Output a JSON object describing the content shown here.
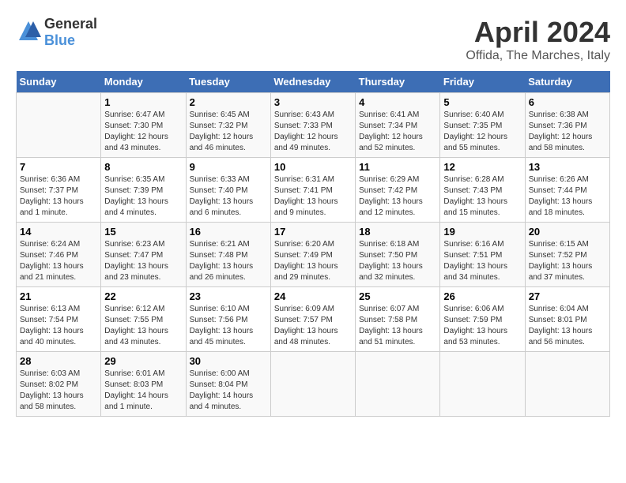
{
  "logo": {
    "general": "General",
    "blue": "Blue"
  },
  "title": "April 2024",
  "subtitle": "Offida, The Marches, Italy",
  "days_header": [
    "Sunday",
    "Monday",
    "Tuesday",
    "Wednesday",
    "Thursday",
    "Friday",
    "Saturday"
  ],
  "weeks": [
    [
      {
        "day": "",
        "info": ""
      },
      {
        "day": "1",
        "info": "Sunrise: 6:47 AM\nSunset: 7:30 PM\nDaylight: 12 hours\nand 43 minutes."
      },
      {
        "day": "2",
        "info": "Sunrise: 6:45 AM\nSunset: 7:32 PM\nDaylight: 12 hours\nand 46 minutes."
      },
      {
        "day": "3",
        "info": "Sunrise: 6:43 AM\nSunset: 7:33 PM\nDaylight: 12 hours\nand 49 minutes."
      },
      {
        "day": "4",
        "info": "Sunrise: 6:41 AM\nSunset: 7:34 PM\nDaylight: 12 hours\nand 52 minutes."
      },
      {
        "day": "5",
        "info": "Sunrise: 6:40 AM\nSunset: 7:35 PM\nDaylight: 12 hours\nand 55 minutes."
      },
      {
        "day": "6",
        "info": "Sunrise: 6:38 AM\nSunset: 7:36 PM\nDaylight: 12 hours\nand 58 minutes."
      }
    ],
    [
      {
        "day": "7",
        "info": "Sunrise: 6:36 AM\nSunset: 7:37 PM\nDaylight: 13 hours\nand 1 minute."
      },
      {
        "day": "8",
        "info": "Sunrise: 6:35 AM\nSunset: 7:39 PM\nDaylight: 13 hours\nand 4 minutes."
      },
      {
        "day": "9",
        "info": "Sunrise: 6:33 AM\nSunset: 7:40 PM\nDaylight: 13 hours\nand 6 minutes."
      },
      {
        "day": "10",
        "info": "Sunrise: 6:31 AM\nSunset: 7:41 PM\nDaylight: 13 hours\nand 9 minutes."
      },
      {
        "day": "11",
        "info": "Sunrise: 6:29 AM\nSunset: 7:42 PM\nDaylight: 13 hours\nand 12 minutes."
      },
      {
        "day": "12",
        "info": "Sunrise: 6:28 AM\nSunset: 7:43 PM\nDaylight: 13 hours\nand 15 minutes."
      },
      {
        "day": "13",
        "info": "Sunrise: 6:26 AM\nSunset: 7:44 PM\nDaylight: 13 hours\nand 18 minutes."
      }
    ],
    [
      {
        "day": "14",
        "info": "Sunrise: 6:24 AM\nSunset: 7:46 PM\nDaylight: 13 hours\nand 21 minutes."
      },
      {
        "day": "15",
        "info": "Sunrise: 6:23 AM\nSunset: 7:47 PM\nDaylight: 13 hours\nand 23 minutes."
      },
      {
        "day": "16",
        "info": "Sunrise: 6:21 AM\nSunset: 7:48 PM\nDaylight: 13 hours\nand 26 minutes."
      },
      {
        "day": "17",
        "info": "Sunrise: 6:20 AM\nSunset: 7:49 PM\nDaylight: 13 hours\nand 29 minutes."
      },
      {
        "day": "18",
        "info": "Sunrise: 6:18 AM\nSunset: 7:50 PM\nDaylight: 13 hours\nand 32 minutes."
      },
      {
        "day": "19",
        "info": "Sunrise: 6:16 AM\nSunset: 7:51 PM\nDaylight: 13 hours\nand 34 minutes."
      },
      {
        "day": "20",
        "info": "Sunrise: 6:15 AM\nSunset: 7:52 PM\nDaylight: 13 hours\nand 37 minutes."
      }
    ],
    [
      {
        "day": "21",
        "info": "Sunrise: 6:13 AM\nSunset: 7:54 PM\nDaylight: 13 hours\nand 40 minutes."
      },
      {
        "day": "22",
        "info": "Sunrise: 6:12 AM\nSunset: 7:55 PM\nDaylight: 13 hours\nand 43 minutes."
      },
      {
        "day": "23",
        "info": "Sunrise: 6:10 AM\nSunset: 7:56 PM\nDaylight: 13 hours\nand 45 minutes."
      },
      {
        "day": "24",
        "info": "Sunrise: 6:09 AM\nSunset: 7:57 PM\nDaylight: 13 hours\nand 48 minutes."
      },
      {
        "day": "25",
        "info": "Sunrise: 6:07 AM\nSunset: 7:58 PM\nDaylight: 13 hours\nand 51 minutes."
      },
      {
        "day": "26",
        "info": "Sunrise: 6:06 AM\nSunset: 7:59 PM\nDaylight: 13 hours\nand 53 minutes."
      },
      {
        "day": "27",
        "info": "Sunrise: 6:04 AM\nSunset: 8:01 PM\nDaylight: 13 hours\nand 56 minutes."
      }
    ],
    [
      {
        "day": "28",
        "info": "Sunrise: 6:03 AM\nSunset: 8:02 PM\nDaylight: 13 hours\nand 58 minutes."
      },
      {
        "day": "29",
        "info": "Sunrise: 6:01 AM\nSunset: 8:03 PM\nDaylight: 14 hours\nand 1 minute."
      },
      {
        "day": "30",
        "info": "Sunrise: 6:00 AM\nSunset: 8:04 PM\nDaylight: 14 hours\nand 4 minutes."
      },
      {
        "day": "",
        "info": ""
      },
      {
        "day": "",
        "info": ""
      },
      {
        "day": "",
        "info": ""
      },
      {
        "day": "",
        "info": ""
      }
    ]
  ]
}
